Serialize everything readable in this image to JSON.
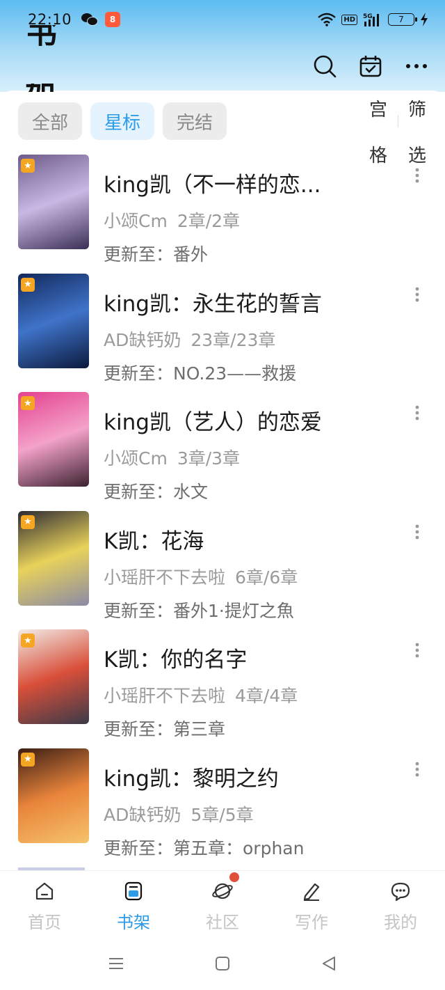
{
  "status_bar": {
    "time": "22:10",
    "battery_level": "7",
    "network_label": "HD",
    "app_badge": "8"
  },
  "header": {
    "title_fragment_top": "书",
    "title_fragment_bottom": "架"
  },
  "filters": {
    "chips": [
      "全部",
      "星标",
      "完结"
    ],
    "active_chip": "星标",
    "view_toggle": [
      "宫",
      "格"
    ],
    "filter_toggle": [
      "筛",
      "选"
    ]
  },
  "books": [
    {
      "title": "king凯（不一样的恋...",
      "author": "小颂Cm",
      "chapters": "2章/2章",
      "update_prefix": "更新至：",
      "update": "番外",
      "cover_colors": [
        "#6d5a8a",
        "#c9b8e3",
        "#3b2f55"
      ]
    },
    {
      "title": "king凯：永生花的誓言",
      "author": "AD缺钙奶",
      "chapters": "23章/23章",
      "update_prefix": "更新至：",
      "update": "NO.23——救援",
      "cover_colors": [
        "#13295c",
        "#3f73c9",
        "#0b1a3d"
      ]
    },
    {
      "title": "king凯（艺人）的恋爱",
      "author": "小颂Cm",
      "chapters": "3章/3章",
      "update_prefix": "更新至：",
      "update": "水文",
      "cover_colors": [
        "#e3418f",
        "#f4a2c9",
        "#3b2230"
      ]
    },
    {
      "title": "K凯：花海",
      "author": "小瑶肝不下去啦",
      "chapters": "6章/6章",
      "update_prefix": "更新至：",
      "update": "番外1·提灯之魚",
      "cover_colors": [
        "#2c2a33",
        "#e8d25a",
        "#8a8aa6"
      ]
    },
    {
      "title": "K凯：你的名字",
      "author": "小瑶肝不下去啦",
      "chapters": "4章/4章",
      "update_prefix": "更新至：",
      "update": "第三章",
      "cover_colors": [
        "#f2ede8",
        "#d94f3a",
        "#3a3a48"
      ]
    },
    {
      "title": "king凯：黎明之约",
      "author": "AD缺钙奶",
      "chapters": "5章/5章",
      "update_prefix": "更新至：",
      "update": "第五章：orphan",
      "cover_colors": [
        "#3b1d14",
        "#e8843b",
        "#f6c46a"
      ]
    }
  ],
  "bottom_nav": {
    "items": [
      "首页",
      "书架",
      "社区",
      "写作",
      "我的"
    ],
    "active": "书架",
    "accent_color": "#2d9be8"
  }
}
